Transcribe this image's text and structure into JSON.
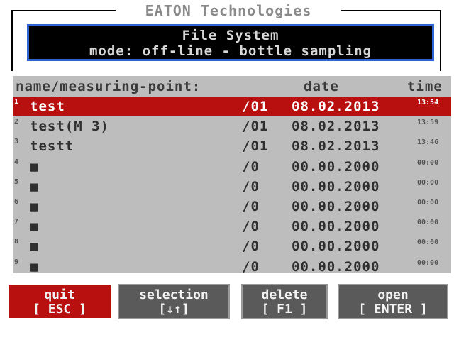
{
  "brand": "EATON Technologies",
  "header": {
    "title": "File System",
    "mode": "mode: off-line - bottle sampling"
  },
  "columns": {
    "name": "name/measuring-point:",
    "date": "date",
    "time": "time"
  },
  "rows": [
    {
      "index": "1",
      "name": "test",
      "point": "/01",
      "date": "08.02.2013",
      "time": "13:54",
      "selected": true
    },
    {
      "index": "2",
      "name": "test(M 3)",
      "point": "/01",
      "date": "08.02.2013",
      "time": "13:59",
      "selected": false
    },
    {
      "index": "3",
      "name": "testt",
      "point": "/01",
      "date": "08.02.2013",
      "time": "13:46",
      "selected": false
    },
    {
      "index": "4",
      "name": "■",
      "point": "/0",
      "date": "00.00.2000",
      "time": "00:00",
      "selected": false
    },
    {
      "index": "5",
      "name": "■",
      "point": "/0",
      "date": "00.00.2000",
      "time": "00:00",
      "selected": false
    },
    {
      "index": "6",
      "name": "■",
      "point": "/0",
      "date": "00.00.2000",
      "time": "00:00",
      "selected": false
    },
    {
      "index": "7",
      "name": "■",
      "point": "/0",
      "date": "00.00.2000",
      "time": "00:00",
      "selected": false
    },
    {
      "index": "8",
      "name": "■",
      "point": "/0",
      "date": "00.00.2000",
      "time": "00:00",
      "selected": false
    },
    {
      "index": "9",
      "name": "■",
      "point": "/0",
      "date": "00.00.2000",
      "time": "00:00",
      "selected": false
    }
  ],
  "function_keys": [
    {
      "label": "quit",
      "key": "[ ESC ]"
    },
    {
      "label": "selection",
      "key": "[↓↑]"
    },
    {
      "label": "delete",
      "key": "[ F1 ]"
    },
    {
      "label": "open",
      "key": "[ ENTER ]"
    }
  ],
  "colors": {
    "selection": "#b80f0f",
    "header_border": "#2f63d6",
    "panel": "#bdbdbd",
    "button": "#5a5a5a"
  }
}
